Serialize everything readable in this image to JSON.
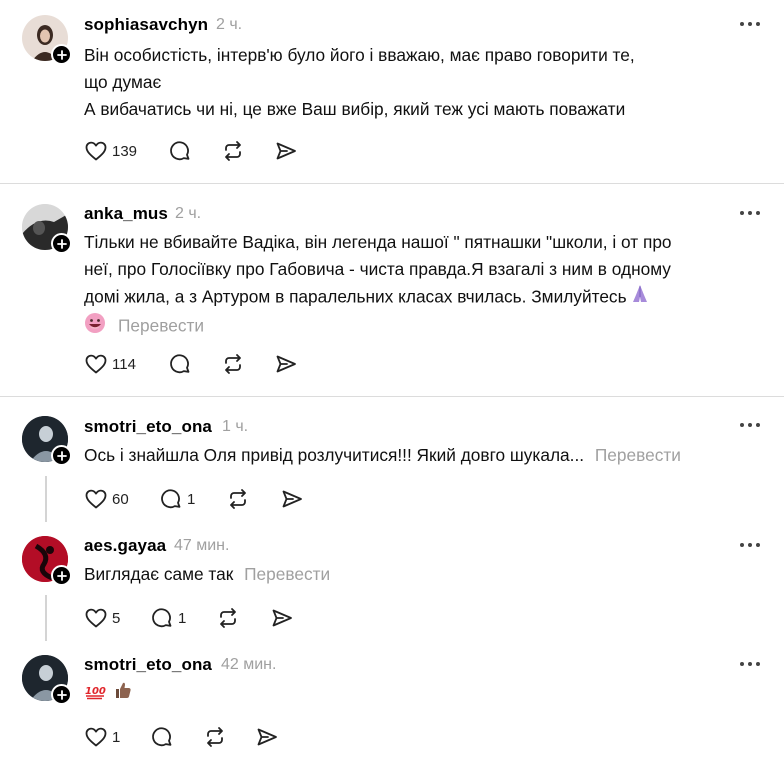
{
  "comments": [
    {
      "username": "sophiasavchyn",
      "time": "2 ч.",
      "lines": [
        "Він особистість, інтерв'ю було його і вважаю, має право говорити те,",
        "що думає",
        "А вибачатись чи ні, це вже Ваш вибір, який теж усі мають поважати"
      ],
      "likes": "139",
      "replies": "",
      "avatar_color": "#d9c8bd"
    },
    {
      "username": "anka_mus",
      "time": "2 ч.",
      "lines": [
        "Тільки не вбивайте Вадіка, він легенда нашої \" пятнашки \"школи, і от про",
        "неї, про Голосіївку про Габовича - чиста правда.Я взагалі з ним в одному",
        "домі жила, а з Артуром в паралельних класах вчилась. Змилуйтесь"
      ],
      "translate": "Перевести",
      "likes": "114",
      "replies": "",
      "avatar_color": "#3a3a3a"
    },
    {
      "username": "smotri_eto_ona",
      "time": "1 ч.",
      "text": "Ось і знайшла Оля привід розлучитися!!! Який довго шукала...",
      "translate": "Перевести",
      "likes": "60",
      "replies": "1",
      "avatar_color": "#2b3540"
    },
    {
      "username": "aes.gayaa",
      "time": "47 мин.",
      "text": "Виглядає саме так",
      "translate": "Перевести",
      "likes": "5",
      "replies": "1",
      "avatar_color": "#c0102a"
    },
    {
      "username": "smotri_eto_ona",
      "time": "42 мин.",
      "text": "",
      "likes": "1",
      "replies": "",
      "avatar_color": "#2b3540"
    }
  ],
  "icons": [
    "heart-icon",
    "comment-icon",
    "repost-icon",
    "share-icon",
    "more-icon",
    "follow-plus-icon"
  ],
  "emojis": [
    "folded-hands-emoji",
    "grinning-face-emoji",
    "hundred-points-emoji",
    "thumbs-up-emoji"
  ]
}
